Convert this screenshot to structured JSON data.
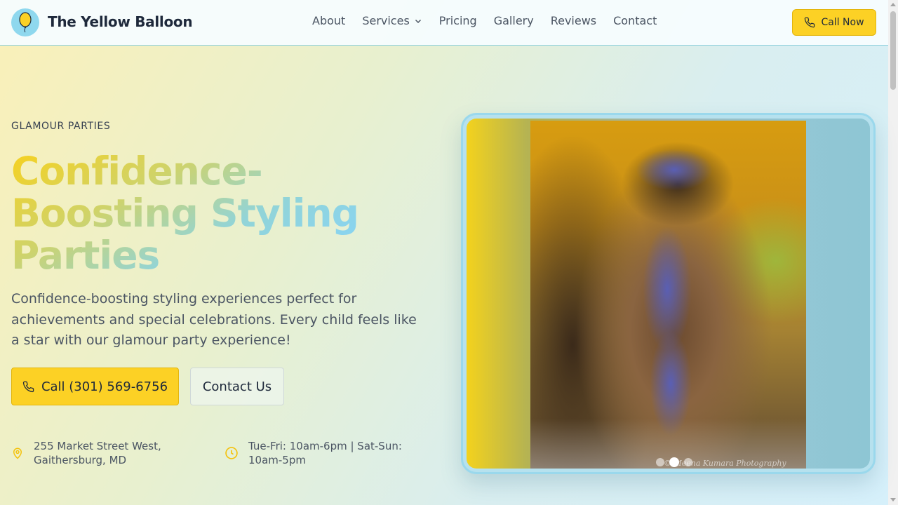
{
  "header": {
    "brand": "The Yellow Balloon",
    "nav": [
      {
        "label": "About"
      },
      {
        "label": "Services"
      },
      {
        "label": "Pricing"
      },
      {
        "label": "Gallery"
      },
      {
        "label": "Reviews"
      },
      {
        "label": "Contact"
      }
    ],
    "call_now": "Call Now"
  },
  "hero": {
    "eyebrow": "GLAMOUR PARTIES",
    "headline": "Confidence-Boosting Styling Parties",
    "subtext": "Confidence-boosting styling experiences perfect for achievements and special celebrations. Every child feels like a star with our glamour party experience!",
    "call_button": "Call (301) 569-6756",
    "contact_button": "Contact Us",
    "address": "255 Market Street West, Gaithersburg, MD",
    "hours": "Tue-Fri: 10am-6pm | Sat-Sun: 10am-5pm"
  },
  "gallery": {
    "caption": "© Meena Kumara Photography 2011",
    "slide_count": 3,
    "active_slide": 2
  },
  "colors": {
    "accent_yellow": "#fcd125",
    "accent_blue": "#8ad4ee",
    "text_dark": "#1e293b"
  },
  "icons": {
    "logo": "balloon-icon",
    "call": "phone-icon",
    "address": "map-pin-icon",
    "hours": "clock-icon",
    "dropdown": "chevron-down-icon"
  }
}
